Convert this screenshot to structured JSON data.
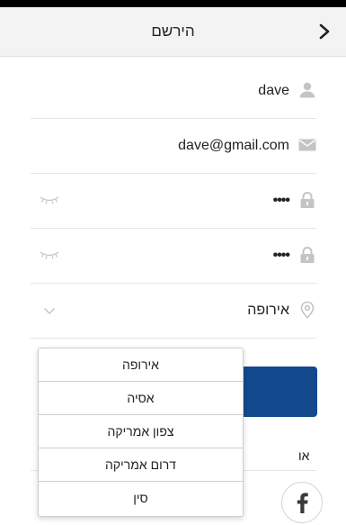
{
  "header": {
    "title": "הירשם",
    "back_icon": "chevron-right-icon"
  },
  "form": {
    "name": {
      "value": "dave",
      "icon": "person-icon"
    },
    "email": {
      "value": "dave@gmail.com",
      "icon": "mail-icon"
    },
    "password": {
      "value": "••••",
      "icon": "lock-icon",
      "toggle_icon": "eye-closed-icon"
    },
    "confirm_password": {
      "value": "••••",
      "icon": "lock-icon",
      "toggle_icon": "eye-closed-icon"
    },
    "region": {
      "value": "אירופה",
      "icon": "location-pin-icon",
      "toggle_icon": "chevron-down-icon"
    }
  },
  "region_options": [
    "אירופה",
    "אסיה",
    "צפון אמריקה",
    "דרום אמריקה",
    "סין"
  ],
  "or_label": "או",
  "social": {
    "facebook_icon": "facebook-icon"
  },
  "colors": {
    "accent": "#124a8d",
    "icon_gray": "#c4c4c4",
    "header_bg": "#f3f3f3"
  }
}
